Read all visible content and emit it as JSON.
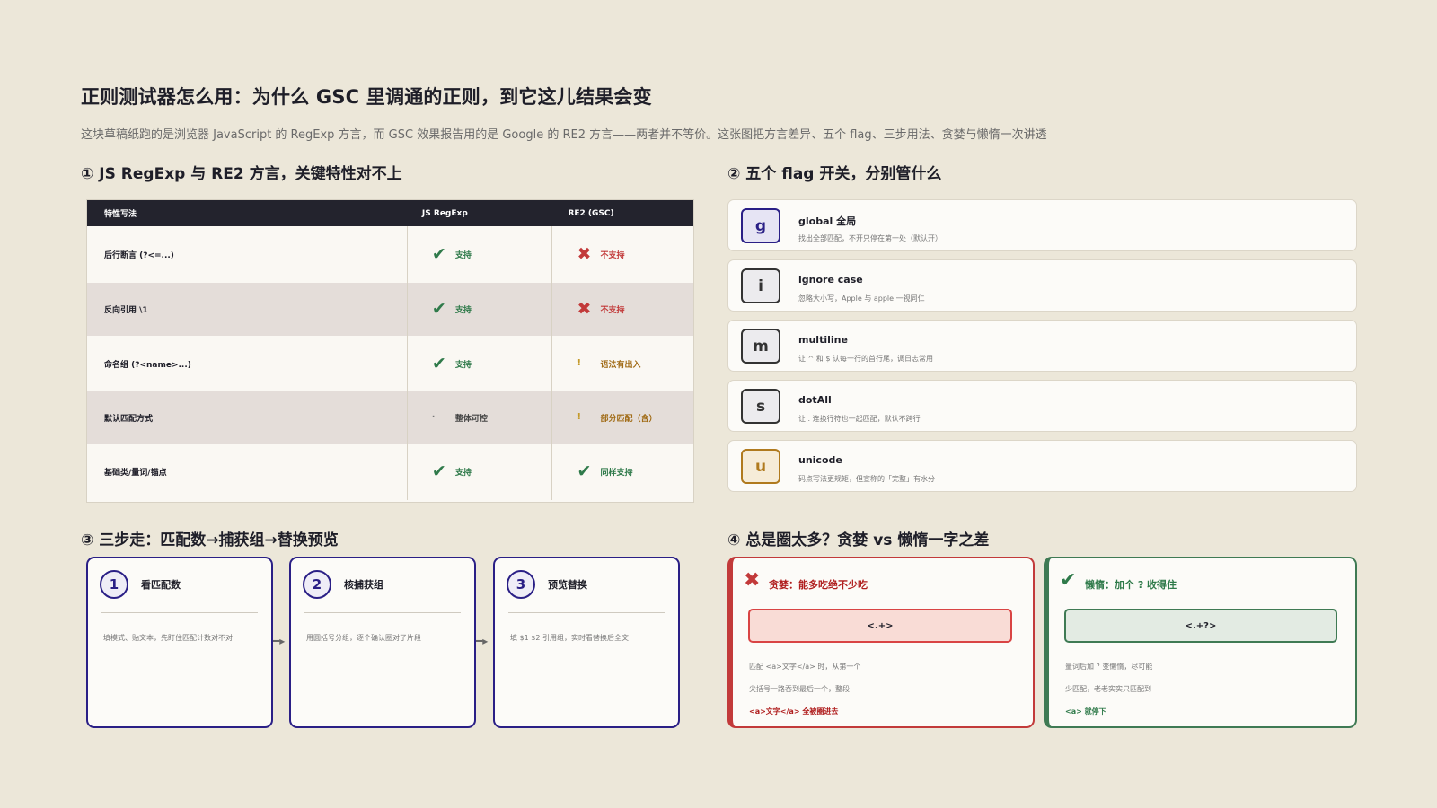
{
  "header": {
    "title": "正则测试器怎么用：为什么 GSC 里调通的正则，到它这儿结果会变",
    "subtitle": "这块草稿纸跑的是浏览器 JavaScript 的 RegExp 方言，而 GSC 效果报告用的是 Google 的 RE2 方言——两者并不等价。这张图把方言差异、五个 flag、三步用法、贪婪与懒惰一次讲透"
  },
  "sections": {
    "s1": "① JS RegExp 与 RE2 方言，关键特性对不上",
    "s2": "② 五个 flag 开关，分别管什么",
    "s3": "③ 三步走：匹配数→捕获组→替换预览",
    "s4": "④ 总是圈太多？贪婪 vs 懒惰一字之差"
  },
  "table": {
    "headers": [
      "特性写法",
      "JS RegExp",
      "RE2 (GSC)"
    ],
    "rows": [
      {
        "feature": "后行断言 (?<=...)",
        "js": {
          "mark": "✔",
          "kind": "ok",
          "text": "支持"
        },
        "re2": {
          "mark": "✖",
          "kind": "no",
          "text": "不支持"
        }
      },
      {
        "feature": "反向引用 \\1",
        "js": {
          "mark": "✔",
          "kind": "ok",
          "text": "支持"
        },
        "re2": {
          "mark": "✖",
          "kind": "no",
          "text": "不支持"
        }
      },
      {
        "feature": "命名组 (?<name>...)",
        "js": {
          "mark": "✔",
          "kind": "ok",
          "text": "支持"
        },
        "re2": {
          "mark": "!",
          "kind": "warn",
          "text": "语法有出入"
        }
      },
      {
        "feature": "默认匹配方式",
        "js": {
          "mark": "·",
          "kind": "neutral",
          "text": "整体可控"
        },
        "re2": {
          "mark": "!",
          "kind": "warn",
          "text": "部分匹配（含）"
        }
      },
      {
        "feature": "基础类/量词/锚点",
        "js": {
          "mark": "✔",
          "kind": "ok",
          "text": "支持"
        },
        "re2": {
          "mark": "✔",
          "kind": "ok",
          "text": "同样支持"
        }
      }
    ]
  },
  "flags": [
    {
      "letter": "g",
      "name": "global 全局",
      "desc": "找出全部匹配，不开只停在第一处（默认开）",
      "color": "#2a1f86",
      "bg": "#e6e4f4"
    },
    {
      "letter": "i",
      "name": "ignore case",
      "desc": "忽略大小写，Apple 与 apple 一视同仁",
      "color": "#333333",
      "bg": "#ecebee"
    },
    {
      "letter": "m",
      "name": "multiline",
      "desc": "让 ^ 和 $ 认每一行的首行尾，调日志常用",
      "color": "#333333",
      "bg": "#ecebee"
    },
    {
      "letter": "s",
      "name": "dotAll",
      "desc": "让 . 连换行符也一起匹配，默认不跨行",
      "color": "#333333",
      "bg": "#ecebee"
    },
    {
      "letter": "u",
      "name": "unicode",
      "desc": "码点写法更规矩，但宣称的「完整」有水分",
      "color": "#b07a1e",
      "bg": "#f6ecd8"
    }
  ],
  "steps": [
    {
      "num": "1",
      "title": "看匹配数",
      "desc": "填模式、贴文本，先盯住匹配计数对不对"
    },
    {
      "num": "2",
      "title": "核捕获组",
      "desc": "用圆括号分组，逐个确认圈对了片段"
    },
    {
      "num": "3",
      "title": "预览替换",
      "desc": "填 $1 $2 引用组，实时看替换后全文"
    }
  ],
  "arrow_glyph": "━▸",
  "greedy": {
    "mark": "✖",
    "title": "贪婪：能多吃绝不少吃",
    "pattern": "<.+>",
    "line1": "匹配 <a>文字</a> 时，从第一个",
    "line2": "尖括号一路吞到最后一个，整段",
    "highlight": "<a>文字</a> 全被圈进去"
  },
  "lazy": {
    "mark": "✔",
    "title": "懒惰：加个 ? 收得住",
    "pattern": "<.+?>",
    "line1": "量词后加 ? 变懒惰，尽可能",
    "line2": "少匹配，老老实实只匹配到",
    "highlight": "<a> 就停下"
  },
  "colors": {
    "ok": "#2f7a4a",
    "no": "#c23a3a",
    "warn": "#a06a14",
    "step_border": "#2a1f86"
  }
}
